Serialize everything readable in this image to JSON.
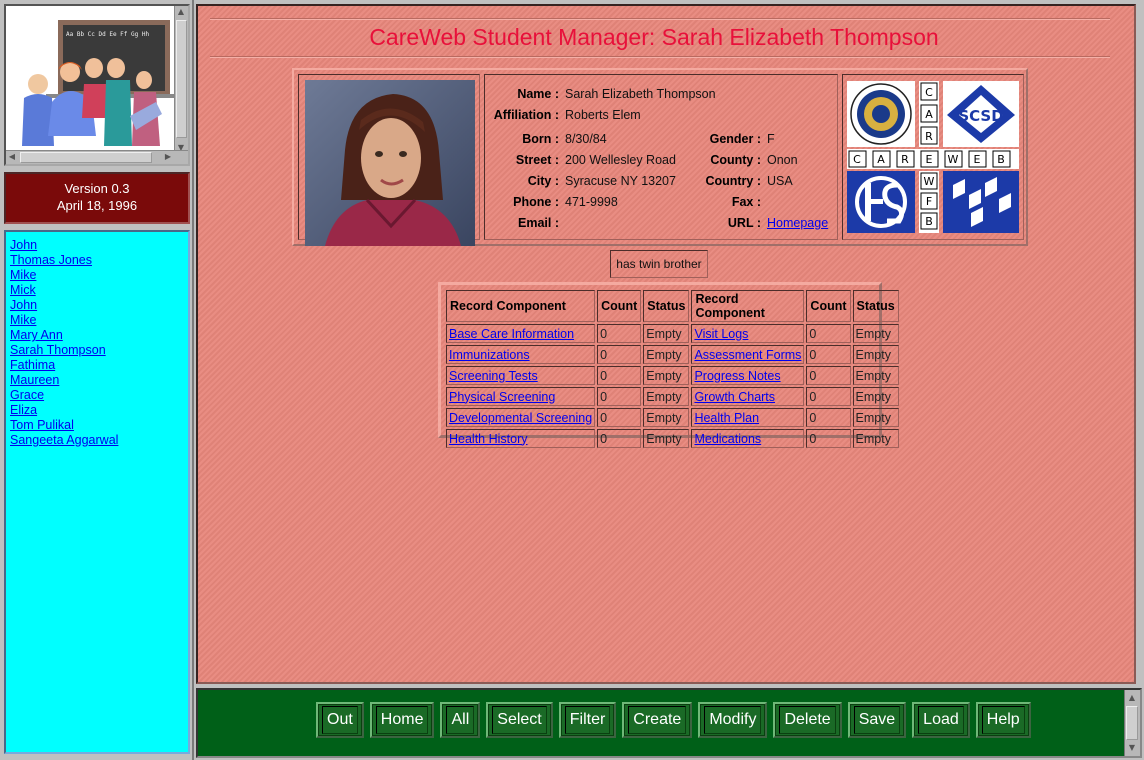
{
  "left": {
    "version_line": "Version 0.3",
    "date_line": "April 18, 1996",
    "students": [
      "John",
      "Thomas Jones",
      "Mike",
      "Mick",
      "John",
      "Mike",
      "Mary Ann",
      "Sarah Thompson",
      "Fathima",
      "Maureen",
      "Grace",
      "Eliza",
      "Tom Pulikal",
      "Sangeeta Aggarwal"
    ]
  },
  "main": {
    "title": "CareWeb Student Manager: Sarah Elizabeth Thompson",
    "fields": {
      "name_label": "Name :",
      "name": "Sarah Elizabeth Thompson",
      "affiliation_label": "Affiliation :",
      "affiliation": "Roberts Elem",
      "born_label": "Born :",
      "born": "8/30/84",
      "gender_label": "Gender :",
      "gender": "F",
      "street_label": "Street :",
      "street": "200 Wellesley Road",
      "county_label": "County :",
      "county": "Onon",
      "city_label": "City :",
      "city": "Syracuse NY 13207",
      "country_label": "Country :",
      "country": "USA",
      "phone_label": "Phone :",
      "phone": "471-9998",
      "fax_label": "Fax :",
      "fax": "",
      "email_label": "Email :",
      "email": "",
      "url_label": "URL :",
      "url": "Homepage"
    },
    "logo_letters_vertical_top": [
      "C",
      "A",
      "R"
    ],
    "logo_letters_row": [
      "C",
      "A",
      "R",
      "E",
      "W",
      "E",
      "B"
    ],
    "logo_letters_vertical_bottom": [
      "W",
      "F",
      "B"
    ],
    "note": "has twin brother",
    "records": {
      "headers": [
        "Record Component",
        "Count",
        "Status",
        "Record Component",
        "Count",
        "Status"
      ],
      "rows": [
        [
          "Base Care Information",
          "0",
          "Empty",
          "Visit Logs",
          "0",
          "Empty"
        ],
        [
          "Immunizations",
          "0",
          "Empty",
          "Assessment Forms",
          "0",
          "Empty"
        ],
        [
          "Screening Tests",
          "0",
          "Empty",
          "Progress Notes",
          "0",
          "Empty"
        ],
        [
          "Physical Screening",
          "0",
          "Empty",
          "Growth Charts",
          "0",
          "Empty"
        ],
        [
          "Developmental Screening",
          "0",
          "Empty",
          "Health Plan",
          "0",
          "Empty"
        ],
        [
          "Health History",
          "0",
          "Empty",
          "Medications",
          "0",
          "Empty"
        ]
      ]
    }
  },
  "toolbar": [
    "Out",
    "Home",
    "All",
    "Select",
    "Filter",
    "Create",
    "Modify",
    "Delete",
    "Save",
    "Load",
    "Help"
  ]
}
